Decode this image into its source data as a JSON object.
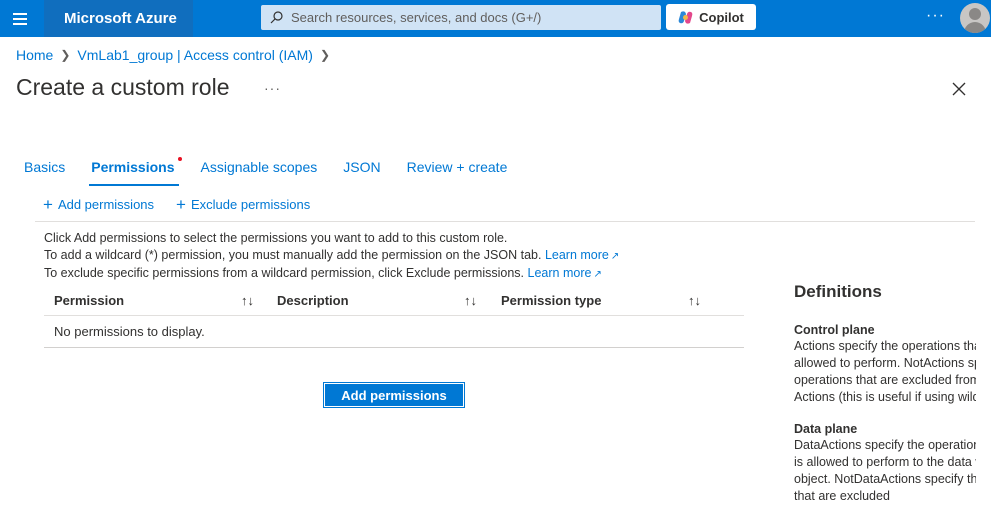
{
  "topbar": {
    "brand": "Microsoft Azure",
    "search_placeholder": "Search resources, services, and docs (G+/)",
    "copilot_label": "Copilot",
    "more_label": "···",
    "brand_color": "#0078d4"
  },
  "breadcrumb": {
    "items": [
      "Home",
      "VmLab1_group | Access control (IAM)"
    ]
  },
  "page": {
    "title": "Create a custom role",
    "more_label": "···"
  },
  "tabs": [
    {
      "label": "Basics",
      "active": false
    },
    {
      "label": "Permissions",
      "active": true
    },
    {
      "label": "Assignable scopes",
      "active": false
    },
    {
      "label": "JSON",
      "active": false
    },
    {
      "label": "Review + create",
      "active": false
    }
  ],
  "toolbar": {
    "add_label": "Add permissions",
    "exclude_label": "Exclude permissions"
  },
  "info": {
    "line1": "Click Add permissions to select the permissions you want to add to this custom role.",
    "line2": "To add a wildcard (*) permission, you must manually add the permission on the JSON tab.",
    "line3": "To exclude specific permissions from a wildcard permission, click Exclude permissions.",
    "learn_more": "Learn more"
  },
  "table": {
    "columns": [
      "Permission",
      "Description",
      "Permission type"
    ],
    "empty_text": "No permissions to display."
  },
  "add_button_label": "Add permissions",
  "definitions": {
    "title": "Definitions",
    "sections": [
      {
        "heading": "Control plane",
        "text": "Actions specify the operations that a role is allowed to perform. NotActions specify the operations that are excluded from the allowed Actions (this is useful if using wildcards)."
      },
      {
        "heading": "Data plane",
        "text": "DataActions specify the operations that a role is allowed to perform to the data within an object. NotDataActions specify the operations that are excluded"
      }
    ]
  }
}
